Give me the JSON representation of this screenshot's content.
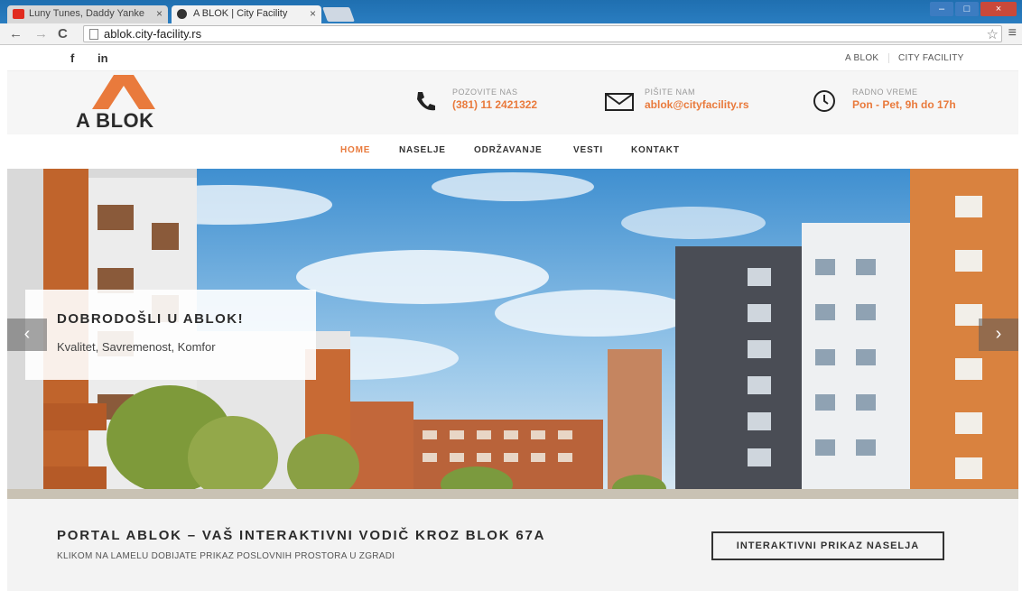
{
  "browser": {
    "tabs": [
      {
        "title": "Luny Tunes, Daddy Yanke",
        "active": false
      },
      {
        "title": "A BLOK | City Facility",
        "active": true
      }
    ],
    "address": "ablok.city-facility.rs"
  },
  "topbar": {
    "social": [
      "f",
      "in"
    ],
    "links": [
      "A BLOK",
      "CITY FACILITY"
    ]
  },
  "header": {
    "logo_text": "A BLOK",
    "contacts": [
      {
        "label": "POZOVITE NAS",
        "value": "(381) 11 2421322",
        "icon": "phone-icon"
      },
      {
        "label": "PIŠITE NAM",
        "value": "ablok@cityfacility.rs",
        "icon": "envelope-icon"
      },
      {
        "label": "RADNO VREME",
        "value": "Pon - Pet, 9h do 17h",
        "icon": "clock-icon"
      }
    ],
    "accent": "#e97a3c"
  },
  "nav": {
    "items": [
      "HOME",
      "NASELJE",
      "ODRŽAVANJE",
      "VESTI",
      "KONTAKT"
    ],
    "active": "HOME"
  },
  "hero": {
    "title": "DOBRODOŠLI U ABLOK!",
    "subtitle": "Kvalitet, Savremenost, Komfor",
    "prev": "‹",
    "next": "›"
  },
  "band": {
    "title": "PORTAL ABLOK – VAŠ INTERAKTIVNI VODIČ KROZ BLOK 67A",
    "subtitle": "KLIKOM NA LAMELU DOBIJATE PRIKAZ POSLOVNIH PROSTORA U ZGRADI",
    "cta": "INTERAKTIVNI PRIKAZ NASELJA"
  }
}
